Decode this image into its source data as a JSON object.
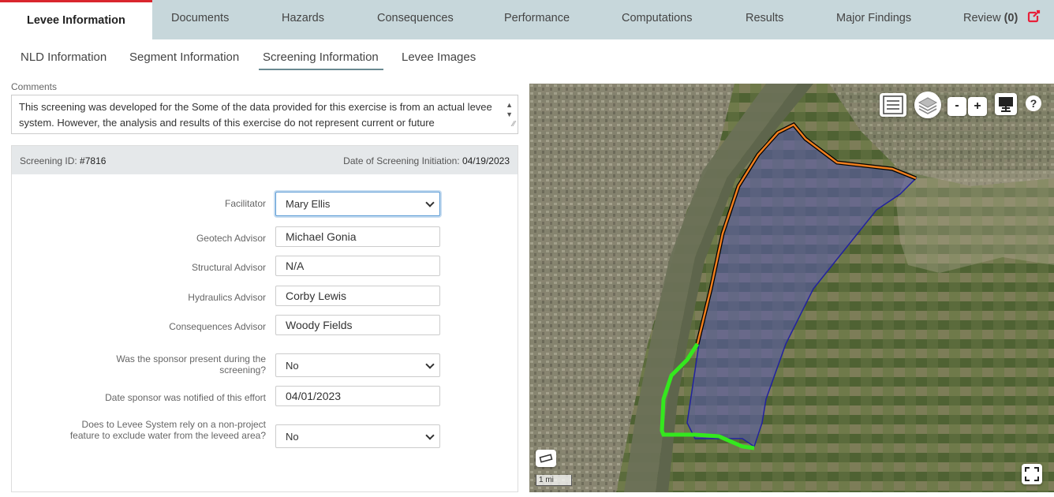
{
  "top_tabs": [
    {
      "label": "Levee Information"
    },
    {
      "label": "Documents"
    },
    {
      "label": "Hazards"
    },
    {
      "label": "Consequences"
    },
    {
      "label": "Performance"
    },
    {
      "label": "Computations"
    },
    {
      "label": "Results"
    },
    {
      "label": "Major Findings"
    },
    {
      "label": "Review",
      "count": "(0)"
    }
  ],
  "sub_tabs": [
    {
      "label": "NLD Information"
    },
    {
      "label": "Segment Information"
    },
    {
      "label": "Screening Information"
    },
    {
      "label": "Levee Images"
    }
  ],
  "comments": {
    "label": "Comments",
    "text": "This screening was developed for the Some of the data provided for this exercise is from an actual levee system.  However, the analysis and results of this exercise do not represent current or future"
  },
  "screening": {
    "id_label": "Screening ID:",
    "id": "#7816",
    "date_label": "Date of Screening Initiation:",
    "date": "04/19/2023"
  },
  "form": {
    "facilitator": {
      "label": "Facilitator",
      "value": "Mary Ellis"
    },
    "geotech": {
      "label": "Geotech Advisor",
      "value": "Michael Gonia"
    },
    "structural": {
      "label": "Structural Advisor",
      "value": "N/A"
    },
    "hydraulics": {
      "label": "Hydraulics Advisor",
      "value": "Corby Lewis"
    },
    "consequences": {
      "label": "Consequences Advisor",
      "value": "Woody Fields"
    },
    "sponsor_present": {
      "label": "Was the sponsor present during the screening?",
      "value": "No"
    },
    "sponsor_notified": {
      "label": "Date sponsor was notified of this effort",
      "value": "04/01/2023"
    },
    "non_project": {
      "label": "Does to Levee System rely on a non-project feature to exclude water from the leveed area?",
      "value": "No"
    }
  },
  "map": {
    "zoom_out": "-",
    "zoom_in": "+",
    "help": "?",
    "scale": "1 mi"
  },
  "colors": {
    "accent_red": "#d9262e",
    "tabbar_bg": "#c7d7db",
    "levee_orange": "#f07f1e",
    "levee_green": "#34e81e",
    "leveed_area": "#5a5ab4"
  }
}
